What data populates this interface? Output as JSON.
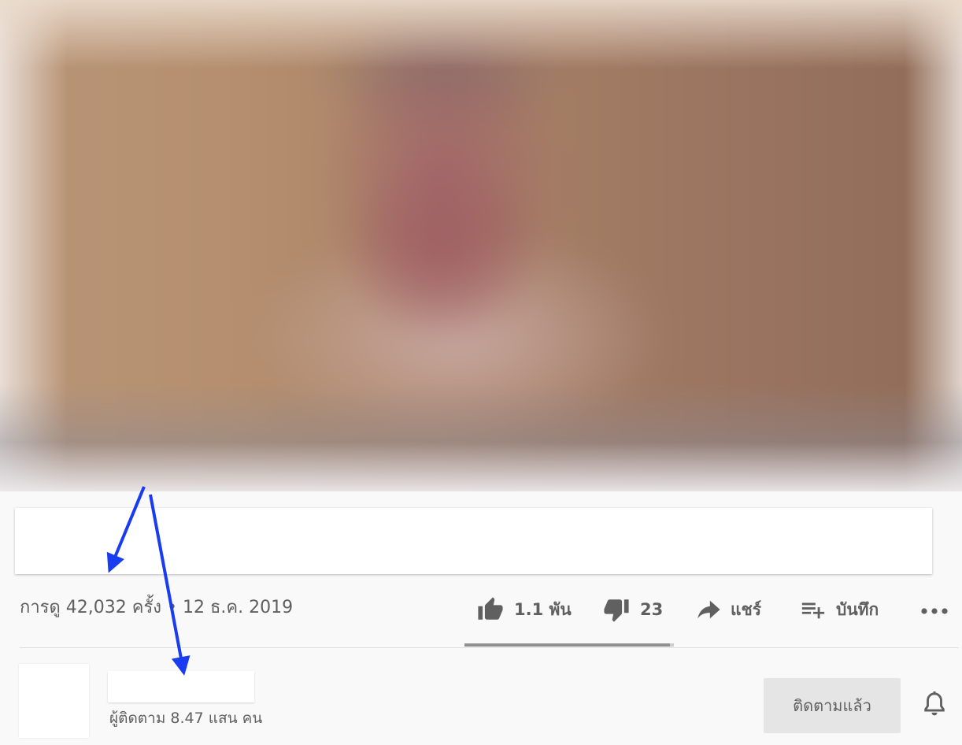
{
  "video": {
    "views_and_date": "การดู 42,032 ครั้ง • 12 ธ.ค. 2019"
  },
  "actions": {
    "like_count": "1.1 พัน",
    "dislike_count": "23",
    "share_label": "แชร์",
    "save_label": "บันทึก",
    "like_ratio": 0.98
  },
  "channel": {
    "subscribers": "ผู้ติดตาม 8.47 แสน คน",
    "subscribed_label": "ติดตามแล้ว"
  },
  "icons": {
    "like": "thumb-up-icon",
    "dislike": "thumb-down-icon",
    "share": "share-arrow-icon",
    "save": "playlist-add-icon",
    "more": "more-horizontal-icon",
    "bell": "bell-icon"
  },
  "colors": {
    "annotation_arrow": "#1a3cf0",
    "text": "#606060",
    "button_bg": "#e5e5e5"
  }
}
